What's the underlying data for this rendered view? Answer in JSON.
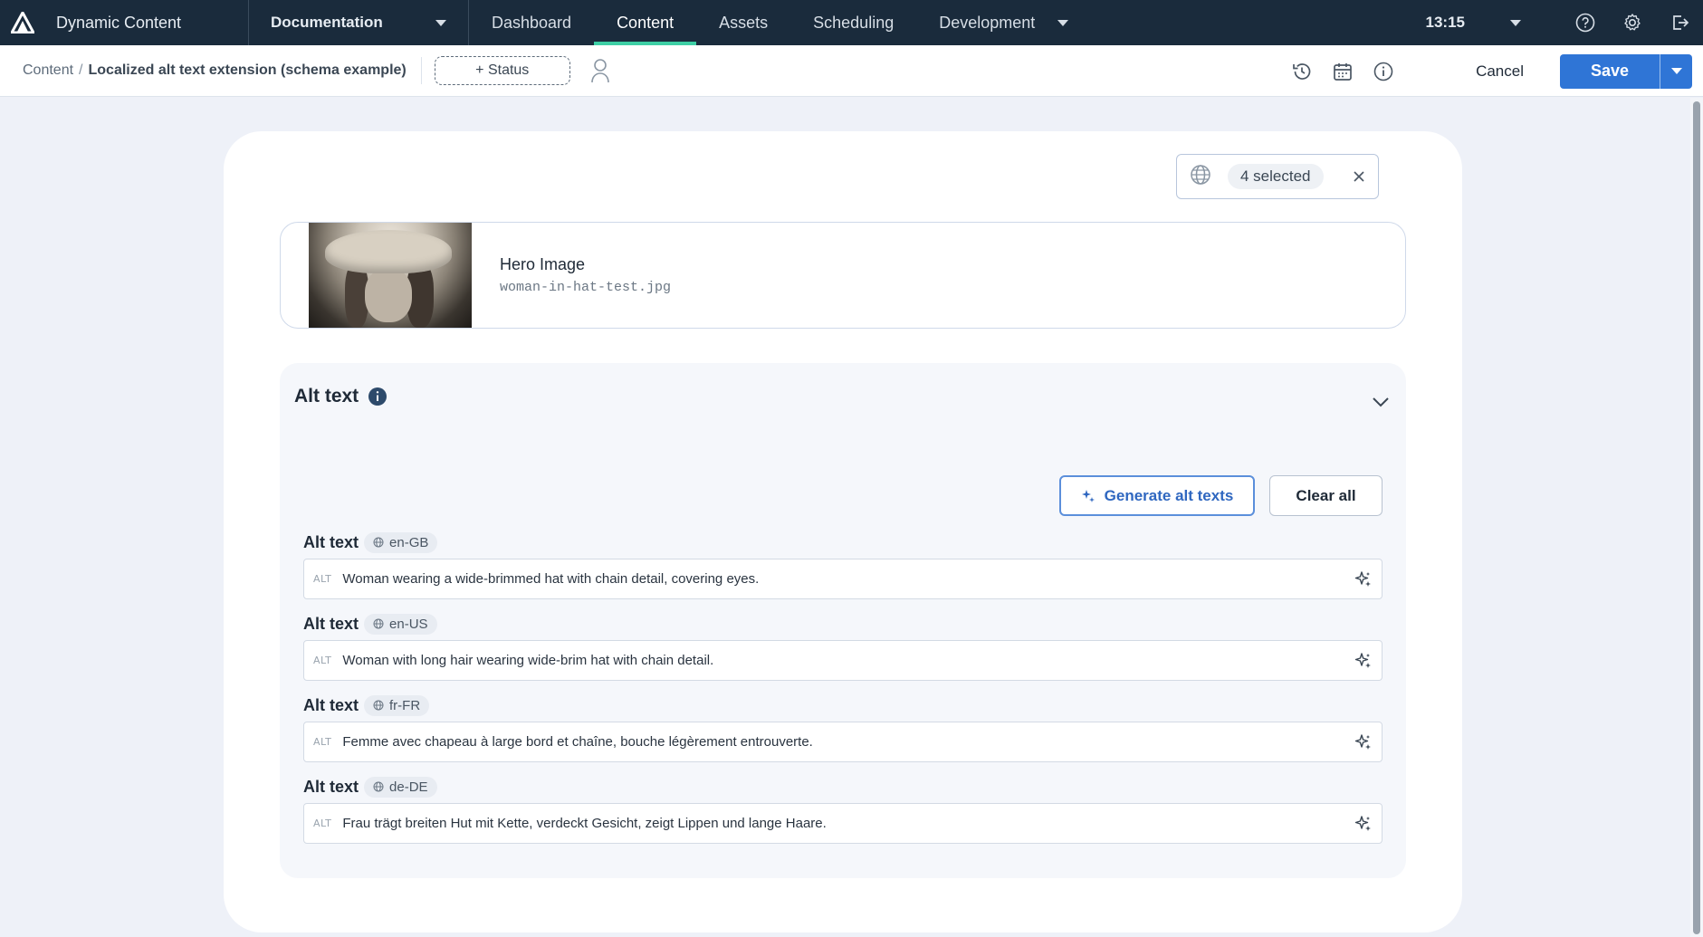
{
  "app": {
    "title": "Dynamic Content"
  },
  "nav": {
    "documentation": "Documentation",
    "tabs": [
      {
        "label": "Dashboard"
      },
      {
        "label": "Content"
      },
      {
        "label": "Assets"
      },
      {
        "label": "Scheduling"
      },
      {
        "label": "Development"
      }
    ],
    "active_tab": "Content",
    "clock": "13:15"
  },
  "breadcrumb": {
    "root": "Content",
    "separator": "/",
    "current": "Localized alt text extension (schema example)"
  },
  "toolbar": {
    "status_label": "+ Status",
    "cancel_label": "Cancel",
    "save_label": "Save"
  },
  "locale_filter": {
    "selected_label": "4 selected"
  },
  "hero": {
    "title": "Hero Image",
    "filename": "woman-in-hat-test.jpg"
  },
  "alt_panel": {
    "title": "Alt text",
    "generate_label": "Generate alt texts",
    "clear_label": "Clear all",
    "prefix": "ALT",
    "items": [
      {
        "label": "Alt text",
        "locale": "en-GB",
        "value": "Woman wearing a wide-brimmed hat with chain detail, covering eyes."
      },
      {
        "label": "Alt text",
        "locale": "en-US",
        "value": "Woman with long hair wearing wide-brim hat with chain detail."
      },
      {
        "label": "Alt text",
        "locale": "fr-FR",
        "value": "Femme avec chapeau à large bord et chaîne, bouche légèrement entrouverte."
      },
      {
        "label": "Alt text",
        "locale": "de-DE",
        "value": "Frau trägt breiten Hut mit Kette, verdeckt Gesicht, zeigt Lippen und lange Haare."
      }
    ]
  },
  "colors": {
    "nav_bg": "#1a2b3c",
    "accent_tab": "#3ecfa5",
    "primary": "#2f75d6"
  }
}
